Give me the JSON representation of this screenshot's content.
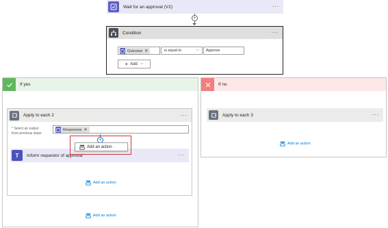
{
  "wait_approval": {
    "title": "Wait for an approval (V2)",
    "more": "···"
  },
  "condition": {
    "title": "Condition",
    "more": "···",
    "left_token": "Outcome",
    "operator": "is equal to",
    "right_value": "Approve",
    "add_label": "Add"
  },
  "if_yes": {
    "label": "If yes",
    "apply_each_2": {
      "title": "Apply to each 2",
      "more": "···",
      "select_label_line1": "* Select an output",
      "select_label_line2": "from previous steps",
      "token": "Responses",
      "add_action_popup": "Add an action",
      "inform": {
        "title": "Inform requestor of approval",
        "more": "···"
      },
      "add_action": "Add an action"
    },
    "add_action": "Add an action"
  },
  "if_no": {
    "label": "If no",
    "apply_each_3": {
      "title": "Apply to each 3",
      "more": "···"
    },
    "add_action": "Add an action"
  },
  "colors": {
    "approval_purple": "#5c5fc7",
    "condition_gray": "#484f58",
    "yes_green": "#5fb85f",
    "yes_bg": "#e8f4e8",
    "no_red": "#f47e7e",
    "no_bg": "#fde7e9",
    "loop_gray": "#6b7280",
    "teams_purple": "#4b53bc",
    "link_blue": "#0078d4",
    "highlight_red": "#d13438"
  }
}
